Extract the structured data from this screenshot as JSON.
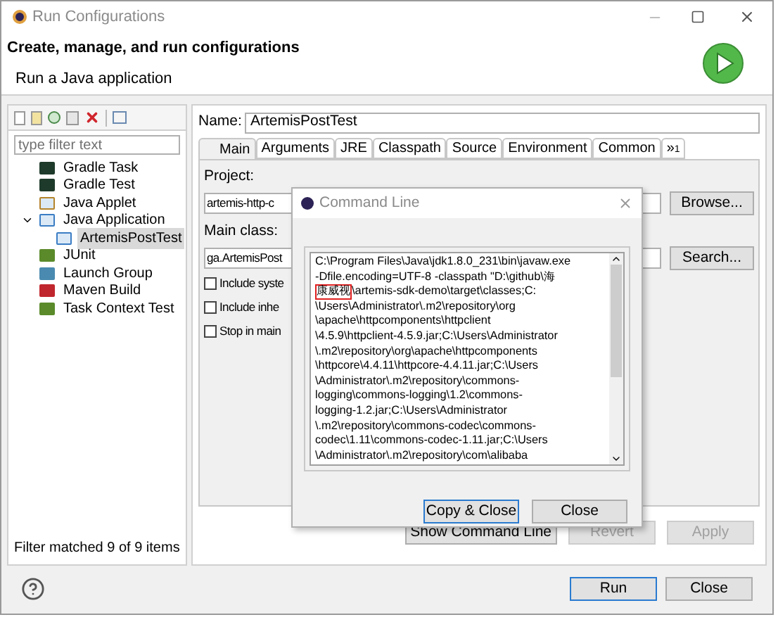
{
  "window": {
    "title": "Run Configurations"
  },
  "header": {
    "title": "Create, manage, and run configurations",
    "subtitle": "Run a Java application"
  },
  "filter": {
    "placeholder": "type filter text"
  },
  "tree": [
    {
      "label": "Gradle Task",
      "selected": false
    },
    {
      "label": "Gradle Test",
      "selected": false
    },
    {
      "label": "Java Applet",
      "selected": false
    },
    {
      "label": "Java Application",
      "expanded": true,
      "selected": false,
      "children": [
        {
          "label": "ArtemisPostTest",
          "selected": true
        }
      ]
    },
    {
      "label": "JUnit",
      "selected": false
    },
    {
      "label": "Launch Group",
      "selected": false
    },
    {
      "label": "Maven Build",
      "selected": false
    },
    {
      "label": "Task Context Test",
      "selected": false
    }
  ],
  "filter_status": "Filter matched 9 of 9 items",
  "name": {
    "label": "Name:",
    "value": "ArtemisPostTest"
  },
  "tabs": [
    {
      "label": "Main",
      "selected": true
    },
    {
      "label": "Arguments",
      "selected": false
    },
    {
      "label": "JRE",
      "selected": false
    },
    {
      "label": "Classpath",
      "selected": false
    },
    {
      "label": "Source",
      "selected": false
    },
    {
      "label": "Environment",
      "selected": false
    },
    {
      "label": "Common",
      "selected": false
    }
  ],
  "tabs_overflow": "»",
  "tabs_overflow_count": "1",
  "project": {
    "label": "Project:",
    "value": "artemis-http-c",
    "button": "Browse..."
  },
  "main_class": {
    "label": "Main class:",
    "value": "ga.ArtemisPost",
    "button": "Search..."
  },
  "options": [
    {
      "label": "Include syste",
      "checked": false
    },
    {
      "label": "Include inhe",
      "checked": false
    },
    {
      "label": "Stop in main",
      "checked": false
    }
  ],
  "panel_buttons": [
    {
      "label": "Show Command Line",
      "disabled": false
    },
    {
      "label": "Revert",
      "disabled": true
    },
    {
      "label": "Apply",
      "disabled": true
    }
  ],
  "footer_buttons": [
    {
      "label": "Run",
      "default": true
    },
    {
      "label": "Close",
      "default": false
    }
  ],
  "dialog": {
    "title": "Command Line",
    "lines": [
      {
        "text": "C:\\Program Files\\Java\\jdk1.8.0_231\\bin\\javaw.exe"
      },
      {
        "text": "-Dfile.encoding=UTF-8 -classpath \"D:\\github\\海"
      },
      {
        "marked": "康威视",
        "text": "\\artemis-sdk-demo\\target\\classes;C:"
      },
      {
        "text": "\\Users\\Administrator\\.m2\\repository\\org"
      },
      {
        "text": "\\apache\\httpcomponents\\httpclient"
      },
      {
        "text": "\\4.5.9\\httpclient-4.5.9.jar;C:\\Users\\Administrator"
      },
      {
        "text": "\\.m2\\repository\\org\\apache\\httpcomponents"
      },
      {
        "text": "\\httpcore\\4.4.11\\httpcore-4.4.11.jar;C:\\Users"
      },
      {
        "text": "\\Administrator\\.m2\\repository\\commons-"
      },
      {
        "text": "logging\\commons-logging\\1.2\\commons-"
      },
      {
        "text": "logging-1.2.jar;C:\\Users\\Administrator"
      },
      {
        "text": "\\.m2\\repository\\commons-codec\\commons-"
      },
      {
        "text": "codec\\1.11\\commons-codec-1.11.jar;C:\\Users"
      },
      {
        "text": "\\Administrator\\.m2\\repository\\com\\alibaba"
      }
    ],
    "buttons": [
      {
        "label": "Copy & Close",
        "default": true
      },
      {
        "label": "Close",
        "default": false
      }
    ]
  }
}
